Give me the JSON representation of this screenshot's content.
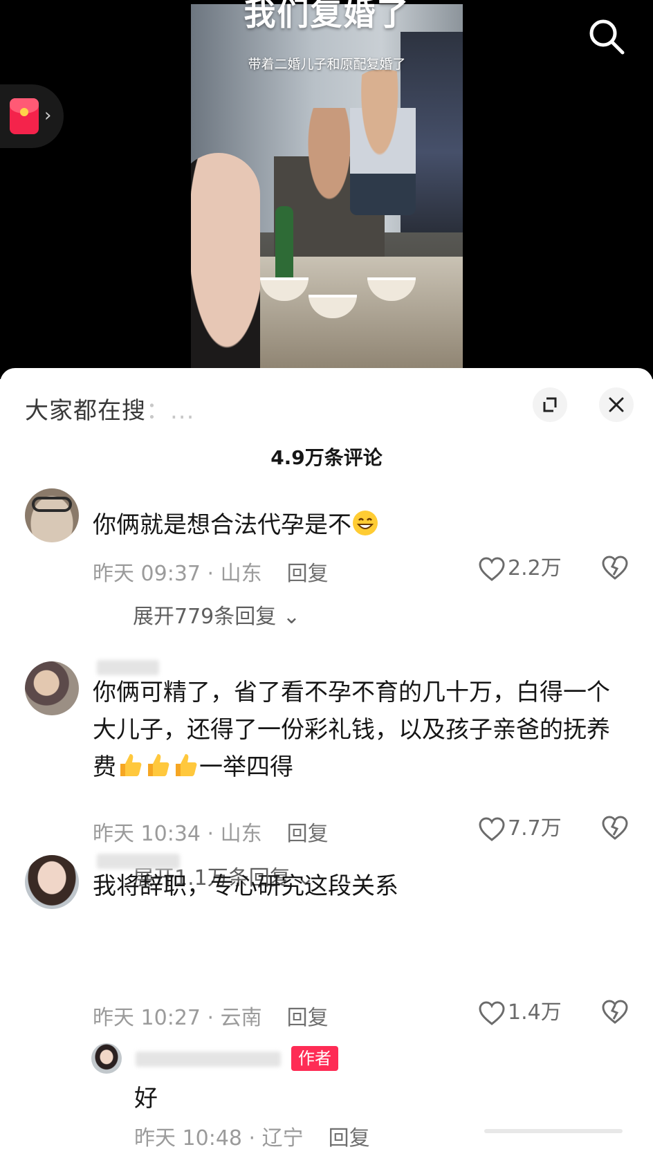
{
  "video": {
    "title": "我们复婚了",
    "subtitle": "带着二婚儿子和原配复婚了"
  },
  "top_bar": {
    "search_icon": "search-icon",
    "red_packet_icon": "red-packet-icon"
  },
  "sheet": {
    "search_prefix": "大家都在搜",
    "search_suffix": "：...",
    "comment_count": "4.9万条评论",
    "expand_icon": "expand-icon",
    "close_icon": "close-icon"
  },
  "comments": [
    {
      "text": "你俩就是想合法代孕是不",
      "emoji": "grinning-face-emoji",
      "time": "昨天 09:37 · 山东",
      "reply_label": "回复",
      "likes": "2.2万",
      "expand_label": "展开779条回复"
    },
    {
      "text": "你俩可精了，省了看不孕不育的几十万，白得一个大儿子，还得了一份彩礼钱，以及孩子亲爸的抚养费",
      "text_tail": "一举四得",
      "emoji": "thumbs-up-emoji",
      "time": "昨天 10:34 · 山东",
      "reply_label": "回复",
      "likes": "7.7万",
      "expand_label": "展开1.1万条回复"
    },
    {
      "text": "我将辞职，专心研究这段关系",
      "time": "昨天 10:27 · 云南",
      "reply_label": "回复",
      "likes": "1.4万"
    }
  ],
  "author_reply": {
    "badge": "作者",
    "text": "好",
    "time": "昨天 10:48 · 辽宁",
    "reply_label": "回复"
  },
  "colors": {
    "accent": "#fe2c55",
    "meta_text": "#9b9b9b",
    "body_text": "#161616"
  }
}
